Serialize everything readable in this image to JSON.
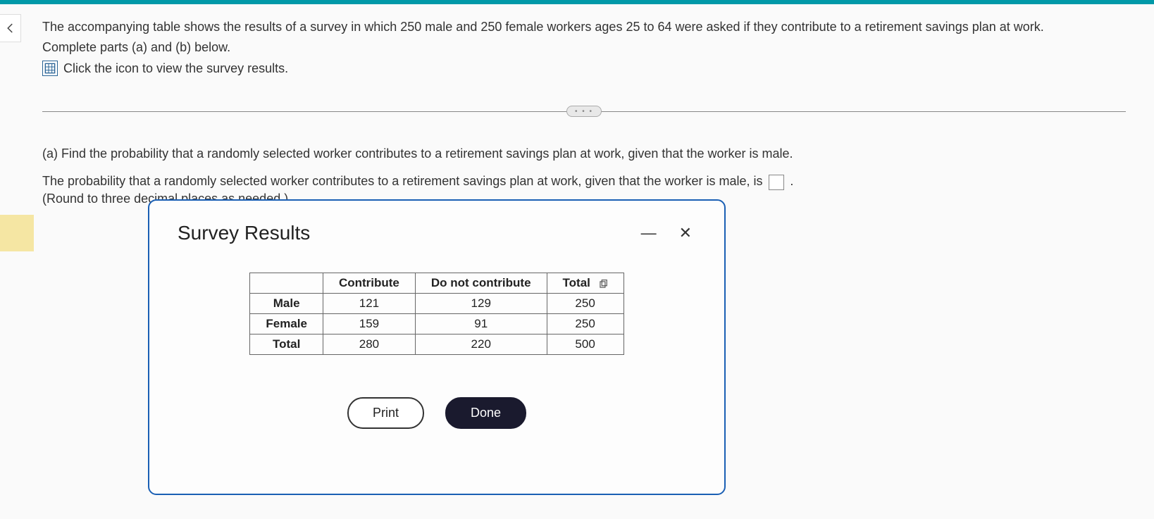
{
  "question": {
    "intro_line1": "The accompanying table shows the results of a survey in which 250 male and 250 female workers ages 25 to 64 were asked if they contribute to a retirement savings plan at work.",
    "intro_line2": "Complete parts (a) and (b) below.",
    "icon_text": "Click the icon to view the survey results."
  },
  "divider": {
    "dots": "• • •"
  },
  "part_a": {
    "prompt": "(a) Find the probability that a randomly selected worker contributes to a retirement savings plan at work, given that the worker is male.",
    "answer_prefix": "The probability that a randomly selected worker contributes to a retirement savings plan at work, given that the worker is male, is",
    "answer_suffix": ".",
    "round_note": "(Round to three decimal places as needed.)"
  },
  "dialog": {
    "title": "Survey Results",
    "minimize": "—",
    "close": "✕",
    "table": {
      "headers": {
        "blank": "",
        "c1": "Contribute",
        "c2": "Do not contribute",
        "c3": "Total"
      },
      "rows": [
        {
          "label": "Male",
          "c1": "121",
          "c2": "129",
          "c3": "250"
        },
        {
          "label": "Female",
          "c1": "159",
          "c2": "91",
          "c3": "250"
        },
        {
          "label": "Total",
          "c1": "280",
          "c2": "220",
          "c3": "500"
        }
      ]
    },
    "print_label": "Print",
    "done_label": "Done"
  },
  "chart_data": {
    "type": "table",
    "title": "Survey Results",
    "columns": [
      "",
      "Contribute",
      "Do not contribute",
      "Total"
    ],
    "rows": [
      [
        "Male",
        121,
        129,
        250
      ],
      [
        "Female",
        159,
        91,
        250
      ],
      [
        "Total",
        280,
        220,
        500
      ]
    ]
  }
}
